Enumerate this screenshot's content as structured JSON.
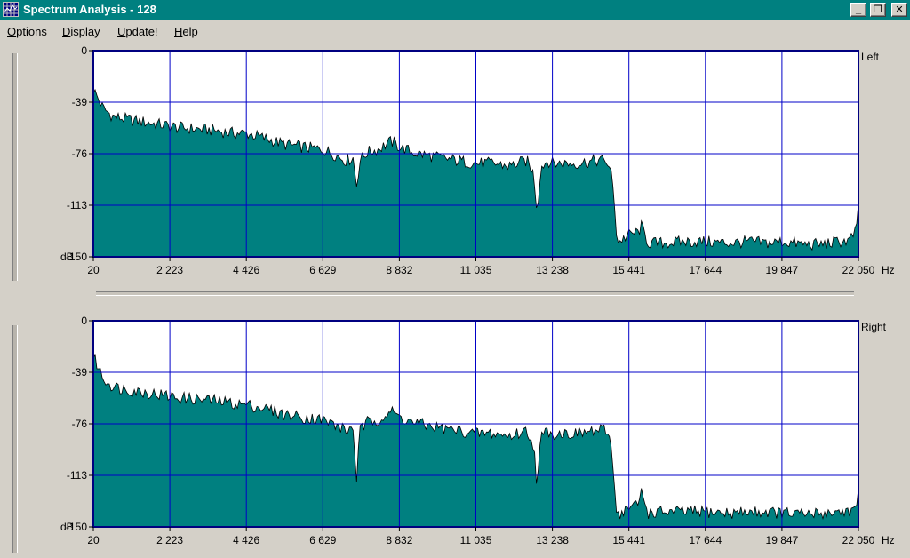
{
  "window": {
    "title": "Spectrum Analysis - 128",
    "buttons": {
      "minimize": "_",
      "restore": "❐",
      "close": "✕"
    }
  },
  "menu": [
    {
      "first": "O",
      "rest": "ptions"
    },
    {
      "first": "D",
      "rest": "isplay"
    },
    {
      "first": "U",
      "rest": "pdate!"
    },
    {
      "first": "H",
      "rest": "elp"
    }
  ],
  "colors": {
    "title_bar": "#008080",
    "fill": "#008080",
    "grid": "#0000c8",
    "plot_bg": "#ffffff"
  },
  "chart_data": [
    {
      "type": "area",
      "channel_label": "Left",
      "x_unit": "Hz",
      "y_unit": "dB",
      "xlim": [
        20,
        22050
      ],
      "ylim": [
        -150,
        0
      ],
      "x_ticks": [
        "20",
        "2 223",
        "4 426",
        "6 629",
        "8 832",
        "11 035",
        "13 238",
        "15 441",
        "17 644",
        "19 847",
        "22 050"
      ],
      "y_ticks": [
        "0",
        "-39",
        "-76",
        "-113",
        "-150"
      ],
      "x": [
        20,
        100,
        300,
        600,
        1000,
        1500,
        2000,
        2500,
        3000,
        3500,
        4000,
        4426,
        5000,
        5500,
        6000,
        6629,
        7000,
        7300,
        7500,
        7600,
        7700,
        7900,
        8200,
        8600,
        8832,
        9200,
        9600,
        10000,
        10500,
        11035,
        11500,
        12000,
        12500,
        12700,
        12800,
        12900,
        13100,
        13238,
        13500,
        14000,
        14500,
        14800,
        14950,
        15050,
        15100,
        15441,
        15700,
        15800,
        16000,
        16500,
        17000,
        17644,
        18300,
        18900,
        19500,
        19847,
        20500,
        21000,
        21500,
        21800,
        22000,
        22050
      ],
      "y": [
        -28,
        -32,
        -42,
        -48,
        -50,
        -52,
        -54,
        -56,
        -57,
        -58,
        -60,
        -60,
        -64,
        -68,
        -70,
        -72,
        -76,
        -80,
        -78,
        -98,
        -80,
        -74,
        -72,
        -66,
        -70,
        -74,
        -76,
        -78,
        -80,
        -82,
        -82,
        -84,
        -80,
        -90,
        -118,
        -85,
        -80,
        -82,
        -82,
        -82,
        -80,
        -80,
        -92,
        -118,
        -140,
        -134,
        -132,
        -128,
        -140,
        -140,
        -139,
        -139,
        -140,
        -139,
        -140,
        -139,
        -141,
        -141,
        -139,
        -138,
        -130,
        -112
      ]
    },
    {
      "type": "area",
      "channel_label": "Right",
      "x_unit": "Hz",
      "y_unit": "dB",
      "xlim": [
        20,
        22050
      ],
      "ylim": [
        -150,
        0
      ],
      "x_ticks": [
        "20",
        "2 223",
        "4 426",
        "6 629",
        "8 832",
        "11 035",
        "13 238",
        "15 441",
        "17 644",
        "19 847",
        "22 050"
      ],
      "y_ticks": [
        "0",
        "-39",
        "-76",
        "-113",
        "-150"
      ],
      "x": [
        20,
        100,
        300,
        600,
        1000,
        1500,
        2000,
        2500,
        3000,
        3500,
        4000,
        4426,
        5000,
        5500,
        6000,
        6629,
        7000,
        7300,
        7500,
        7600,
        7700,
        7900,
        8200,
        8600,
        8832,
        9200,
        9600,
        10000,
        10500,
        11035,
        11500,
        12000,
        12500,
        12700,
        12800,
        12900,
        13100,
        13238,
        13500,
        14000,
        14500,
        14800,
        14950,
        15050,
        15100,
        15441,
        15700,
        15800,
        16000,
        16500,
        17000,
        17644,
        18300,
        18900,
        19500,
        19847,
        20500,
        21000,
        21500,
        21800,
        22000,
        22050
      ],
      "y": [
        -26,
        -30,
        -42,
        -48,
        -50,
        -52,
        -54,
        -56,
        -57,
        -58,
        -60,
        -61,
        -64,
        -68,
        -70,
        -72,
        -76,
        -80,
        -78,
        -115,
        -80,
        -74,
        -72,
        -66,
        -70,
        -74,
        -76,
        -78,
        -80,
        -82,
        -82,
        -84,
        -80,
        -90,
        -122,
        -85,
        -80,
        -82,
        -82,
        -82,
        -80,
        -80,
        -92,
        -128,
        -142,
        -136,
        -134,
        -124,
        -140,
        -139,
        -139,
        -139,
        -140,
        -139,
        -139,
        -140,
        -141,
        -140,
        -139,
        -138,
        -138,
        -126
      ]
    }
  ]
}
